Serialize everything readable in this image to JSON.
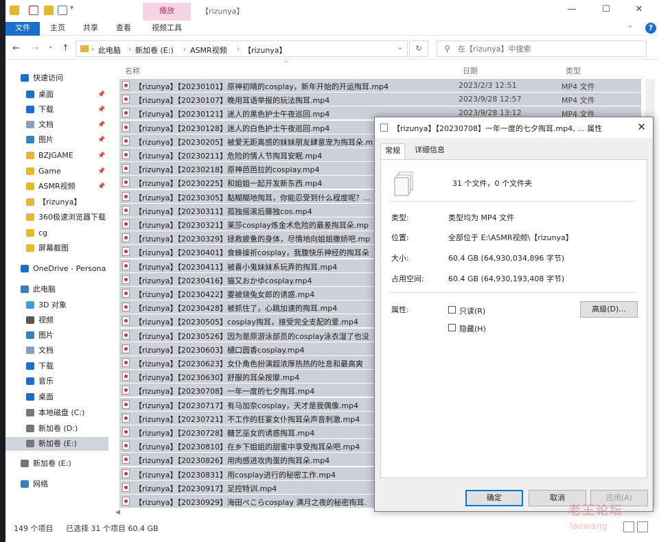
{
  "titlebar": {
    "context_tab": "播放",
    "title": "【rizunya】"
  },
  "ribbon": {
    "tabs": [
      "文件",
      "主页",
      "共享",
      "查看",
      "视频工具"
    ]
  },
  "address": {
    "crumbs": [
      "此电脑",
      "新加卷 (E:)",
      "ASMR视频",
      "【rizunya】"
    ],
    "search_placeholder": "在【rizunya】中搜索"
  },
  "nav": {
    "items": [
      {
        "label": "快速访问",
        "icon": "star-icon",
        "color": "#1a6fcb",
        "pinned": false,
        "indent": 0
      },
      {
        "label": "桌面",
        "icon": "desktop-icon",
        "color": "#1a6fcb",
        "pinned": true,
        "indent": 1
      },
      {
        "label": "下载",
        "icon": "download-icon",
        "color": "#1a6fcb",
        "pinned": true,
        "indent": 1
      },
      {
        "label": "文档",
        "icon": "document-icon",
        "color": "#8aa0b8",
        "pinned": true,
        "indent": 1
      },
      {
        "label": "图片",
        "icon": "pictures-icon",
        "color": "#3a7fbf",
        "pinned": true,
        "indent": 1
      },
      {
        "label": "BZJGAME",
        "icon": "folder-icon",
        "color": "#e8b730",
        "pinned": true,
        "indent": 1
      },
      {
        "label": "Game",
        "icon": "folder-icon",
        "color": "#e8b730",
        "pinned": true,
        "indent": 1
      },
      {
        "label": "ASMR视频",
        "icon": "folder-icon",
        "color": "#e8b730",
        "pinned": true,
        "indent": 1
      },
      {
        "label": "【rizunya】",
        "icon": "folder-icon",
        "color": "#e8b730",
        "pinned": false,
        "indent": 1
      },
      {
        "label": "360极速浏览器下载",
        "icon": "folder-icon",
        "color": "#e8b730",
        "pinned": false,
        "indent": 1
      },
      {
        "label": "cg",
        "icon": "folder-icon",
        "color": "#e8b730",
        "pinned": false,
        "indent": 1
      },
      {
        "label": "屏幕截图",
        "icon": "folder-icon",
        "color": "#e8b730",
        "pinned": false,
        "indent": 1
      },
      {
        "label": "OneDrive - Persona",
        "icon": "cloud-icon",
        "color": "#1a6fcb",
        "pinned": false,
        "indent": 0
      },
      {
        "label": "此电脑",
        "icon": "computer-icon",
        "color": "#3a7fbf",
        "pinned": false,
        "indent": 0
      },
      {
        "label": "3D 对象",
        "icon": "cube-icon",
        "color": "#3aa0d8",
        "pinned": false,
        "indent": 1
      },
      {
        "label": "视频",
        "icon": "video-icon",
        "color": "#555555",
        "pinned": false,
        "indent": 1
      },
      {
        "label": "图片",
        "icon": "pictures-icon",
        "color": "#3a7fbf",
        "pinned": false,
        "indent": 1
      },
      {
        "label": "文档",
        "icon": "document-icon",
        "color": "#8aa0b8",
        "pinned": false,
        "indent": 1
      },
      {
        "label": "下载",
        "icon": "download-icon",
        "color": "#1a6fcb",
        "pinned": false,
        "indent": 1
      },
      {
        "label": "音乐",
        "icon": "music-icon",
        "color": "#1a6fcb",
        "pinned": false,
        "indent": 1
      },
      {
        "label": "桌面",
        "icon": "desktop-icon",
        "color": "#1a6fcb",
        "pinned": false,
        "indent": 1
      },
      {
        "label": "本地磁盘 (C:)",
        "icon": "drive-icon",
        "color": "#777777",
        "pinned": false,
        "indent": 1
      },
      {
        "label": "新加卷 (D:)",
        "icon": "drive-icon",
        "color": "#777777",
        "pinned": false,
        "indent": 1
      },
      {
        "label": "新加卷 (E:)",
        "icon": "drive-icon",
        "color": "#777777",
        "pinned": false,
        "indent": 1,
        "selected": true
      },
      {
        "label": "新加卷 (E:)",
        "icon": "drive-icon",
        "color": "#777777",
        "pinned": false,
        "indent": 0
      },
      {
        "label": "网络",
        "icon": "network-icon",
        "color": "#3a7fbf",
        "pinned": false,
        "indent": 0
      }
    ]
  },
  "columns": {
    "name": "名称",
    "date": "日期",
    "type": "类型"
  },
  "files": [
    {
      "name": "【rizunya】【20230101】原神初晴的cosplay，新年开始的开运掏耳.mp4",
      "date": "2023/2/3 12:51",
      "type": "MP4 文件"
    },
    {
      "name": "【rizunya】【20230107】晚用耳语举报的玩法掏耳.mp4",
      "date": "2023/9/28 12:57",
      "type": "MP4 文件"
    },
    {
      "name": "【rizunya】【20230121】迷人的黑色护士午夜巡回.mp4",
      "date": "2023/9/28 13:12",
      "type": "MP4 文件"
    },
    {
      "name": "【rizunya】【20230128】迷人的白色护士午夜巡回.mp4",
      "date": "",
      "type": ""
    },
    {
      "name": "【rizunya】【20230205】被爱无距离感的妹妹朋友肆意宠为掏耳朵.m",
      "date": "",
      "type": ""
    },
    {
      "name": "【rizunya】【20230211】危险的情人节掏耳安眠.mp4",
      "date": "",
      "type": ""
    },
    {
      "name": "【rizunya】【20230218】原神芭芭拉的cosplay.mp4",
      "date": "",
      "type": ""
    },
    {
      "name": "【rizunya】【20230225】和姐姐一起开发新东西.mp4",
      "date": "",
      "type": ""
    },
    {
      "name": "【rizunya】【20230305】黏糊糊地掏耳，你能忍受到什么程度呢？...",
      "date": "",
      "type": ""
    },
    {
      "name": "【rizunya】【20230311】孤独摇滚后藤独cos.mp4",
      "date": "",
      "type": ""
    },
    {
      "name": "【rizunya】【20230321】莱莎cosplay炼金术危险的最差掏耳朵.mp",
      "date": "",
      "type": ""
    },
    {
      "name": "【rizunya】【20230329】拯救疲惫的身体，尽情地向姐姐撒娇吧.mp",
      "date": "",
      "type": ""
    },
    {
      "name": "【rizunya】【20230401】食蜂操祈cosplay，我腹快乐神经的掏耳朵",
      "date": "",
      "type": ""
    },
    {
      "name": "【rizunya】【20230411】被喜小鬼妹妹系玩弄的掏耳.mp4",
      "date": "",
      "type": ""
    },
    {
      "name": "【rizunya】【20230416】猫又おかゆcosplay.mp4",
      "date": "",
      "type": ""
    },
    {
      "name": "【rizunya】【20230422】要被烧兔女郎的诱惑.mp4",
      "date": "",
      "type": ""
    },
    {
      "name": "【rizunya】【20230428】被抓住了，心跳加速的掏耳.mp4",
      "date": "",
      "type": ""
    },
    {
      "name": "【rizunya】【20230505】cosplay掏耳，接受完全支配的爱.mp4",
      "date": "",
      "type": ""
    },
    {
      "name": "【rizunya】【20230526】因为是原游泳部员的cosplay泳衣湿了也没",
      "date": "",
      "type": ""
    },
    {
      "name": "【rizunya】【20230603】樋口圆香cosplay.mp4",
      "date": "",
      "type": ""
    },
    {
      "name": "【rizunya】【20230623】女仆角色扮演超浓厚热热的吐息和最高爽",
      "date": "",
      "type": ""
    },
    {
      "name": "【rizunya】【20230630】舒服的耳朵按摩.mp4",
      "date": "",
      "type": ""
    },
    {
      "name": "【rizunya】【20230708】一年一度的七夕掏耳.mp4",
      "date": "",
      "type": ""
    },
    {
      "name": "【rizunya】【20230717】有马加奈cosplay，天才是我偶像.mp4",
      "date": "",
      "type": ""
    },
    {
      "name": "【rizunya】【20230721】不工作的狂宴女仆掏耳朵声音刺激.mp4",
      "date": "",
      "type": ""
    },
    {
      "name": "【rizunya】【20230728】糖艺巫女的诱惑掏耳.mp4",
      "date": "",
      "type": ""
    },
    {
      "name": "【rizunya】【20230810】在乡下姐姐的甜蜜中享受掏耳朵吧.mp4",
      "date": "",
      "type": ""
    },
    {
      "name": "【rizunya】【20230826】用肉感进攻肉蛋的掏耳朵.mp4",
      "date": "",
      "type": ""
    },
    {
      "name": "【rizunya】【20230831】用cosplay进行的秘密工作.mp4",
      "date": "",
      "type": ""
    },
    {
      "name": "【rizunya】【20230917】足控特训.mp4",
      "date": "",
      "type": ""
    },
    {
      "name": "【rizunya】【20230929】海田ぺこらcosplay 满月之夜的秘密掏耳.",
      "date": "",
      "type": ""
    }
  ],
  "status": {
    "count": "149 个项目",
    "selected": "已选择 31 个项目  60.4 GB"
  },
  "dialog": {
    "title": "【rizunya】【20230708】一年一度的七夕掏耳.mp4, ... 属性",
    "tabs": {
      "general": "常规",
      "detail": "详细信息"
    },
    "summary": "31 个文件，0 个文件夹",
    "rows": [
      {
        "label": "类型:",
        "value": "类型均为 MP4 文件"
      },
      {
        "label": "位置:",
        "value": "全部位于 E:\\ASMR视频\\【rizunya】"
      },
      {
        "label": "大小:",
        "value": "60.4 GB (64,930,034,896 字节)"
      },
      {
        "label": "占用空间:",
        "value": "60.4 GB (64,930,193,408 字节)"
      }
    ],
    "attr_label": "属性:",
    "readonly": "只读(R)",
    "hidden": "隐藏(H)",
    "advanced": "高级(D)...",
    "ok": "确定",
    "cancel": "取消",
    "apply": "应用(A)"
  },
  "watermark": {
    "line1": "老王论坛",
    "line2": "laowang"
  }
}
